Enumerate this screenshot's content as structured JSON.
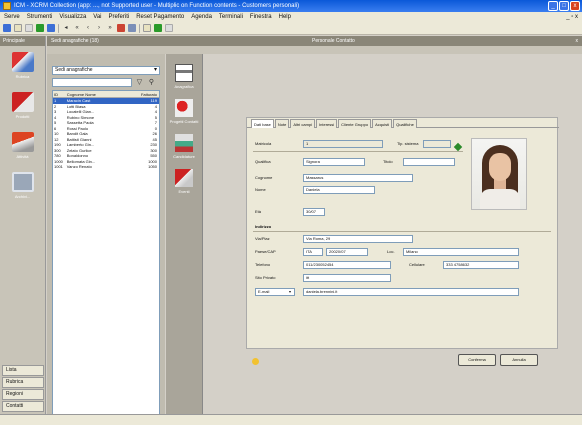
{
  "window": {
    "title": "ICM - XCRM Collection (app: ..., not Supported user - Multiplic on Function contents - Customers personali)"
  },
  "menu": [
    "Serve",
    "Strumenti",
    "Visualizza",
    "Vai",
    "Preferiti",
    "Reset Pagamento",
    "Agenda",
    "Terminali",
    "Finestra",
    "Help"
  ],
  "rail": {
    "header": "Principale",
    "items": [
      {
        "label": "Rubrica"
      },
      {
        "label": "Prodotti"
      },
      {
        "label": "Attività"
      },
      {
        "label": "Archivi..."
      }
    ],
    "bottom": [
      "Lista",
      "Rubrica",
      "Regioni",
      "Contatti"
    ]
  },
  "list": {
    "header": "Sedi anagrafiche (18)",
    "filter_value": "Sedi anagrafiche",
    "columns": [
      "ID",
      "Cognome Nome",
      "Fatturato"
    ],
    "rows": [
      [
        "1",
        "Maracin Cast",
        "119"
      ],
      [
        "2",
        "Lotti Biasa",
        "4"
      ],
      [
        "3",
        "Locatelli Gian...",
        "4"
      ],
      [
        "4",
        "Rubino Simone",
        "5"
      ],
      [
        "5",
        "Sassetta Paola",
        "7"
      ],
      [
        "6",
        "Rossi Paolo",
        "0"
      ],
      [
        "10",
        "Bandit Gala",
        "26"
      ],
      [
        "12",
        "Battisti Gianni",
        "45"
      ],
      [
        "190",
        "Lamberto Gin...",
        "230"
      ],
      [
        "300",
        "Zelato Gurlice",
        "300"
      ],
      [
        "780",
        "Bonaldonno",
        "550"
      ],
      [
        "1000",
        "Bellomata Gin...",
        "1000"
      ],
      [
        "1001",
        "Vanzo Renato",
        "1050"
      ]
    ]
  },
  "strip": [
    "Anagrafica",
    "Progetti Contatti",
    "Candidature",
    "Eventi"
  ],
  "main": {
    "title": "Personale Contatto"
  },
  "tabs": [
    "Dati base",
    "Note",
    "Altri campi",
    "Interessi",
    "Cliente Gruppo",
    "Acquisti",
    "Qualifiche"
  ],
  "form": {
    "matricola_label": "Matricola",
    "matricola_value": "1",
    "tipo_label": "Tip. sistema",
    "tipo_value": "",
    "qualifica_label": "Qualifica",
    "qualifica_value": "Signora",
    "titolo_label": "Titolo",
    "titolo_value": "",
    "cognome_label": "Cognome",
    "cognome_value": "Massarus",
    "nome_label": "Nome",
    "nome_value": "Daniela",
    "eta_label": "Età",
    "eta_value": "30/07",
    "indirizzo_section": "Indirizzo",
    "via_label": "Via/Piaz",
    "via_value": "Via Roma, 29",
    "paese_label": "Paese/CAP",
    "paese_code": "ITA",
    "cap_value": "20020/07",
    "loc_label": "Loc.",
    "loc_value": "Milano",
    "telefono_label": "Telefono",
    "telefono_value": "011/230052454",
    "cellulare_label": "Cellulare",
    "cellulare_value": "333 4758632",
    "email_label": "Sito Privato",
    "email_value": "itt",
    "mail_type": "E-mail",
    "mail_value": "daniela.brennini.it"
  },
  "buttons": {
    "ok": "Conferma",
    "cancel": "Annulla"
  }
}
